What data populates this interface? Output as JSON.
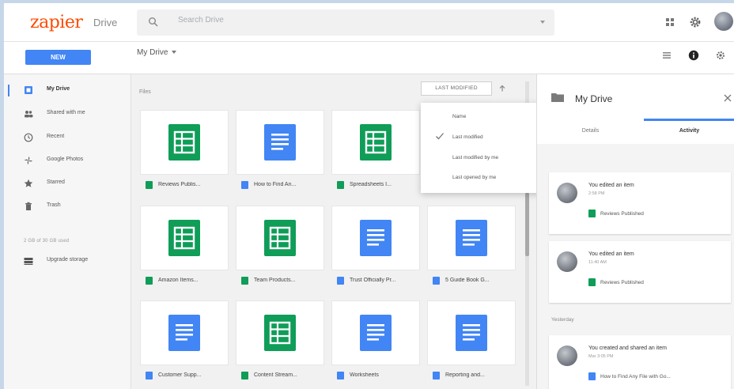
{
  "header": {
    "logo_text": "zapier",
    "product": "Drive",
    "search_placeholder": "Search Drive"
  },
  "toolbar": {
    "new_label": "NEW",
    "breadcrumb": "My Drive"
  },
  "sidebar": {
    "items": [
      {
        "label": "My Drive",
        "icon": "drive-icon",
        "active": true
      },
      {
        "label": "Shared with me",
        "icon": "people-icon",
        "active": false
      },
      {
        "label": "Recent",
        "icon": "clock-icon",
        "active": false
      },
      {
        "label": "Google Photos",
        "icon": "pinwheel-icon",
        "active": false
      },
      {
        "label": "Starred",
        "icon": "star-icon",
        "active": false
      },
      {
        "label": "Trash",
        "icon": "trash-icon",
        "active": false
      }
    ],
    "storage_label": "2 GB of 30 GB used",
    "upgrade_label": "Upgrade storage"
  },
  "main": {
    "files_label": "Files",
    "sort_label": "LAST MODIFIED",
    "files": [
      {
        "name": "Reviews Publis...",
        "type": "sheet"
      },
      {
        "name": "How to Find An...",
        "type": "doc"
      },
      {
        "name": "Spreadsheets I...",
        "type": "sheet"
      },
      {
        "name": "Amazon Items...",
        "type": "sheet"
      },
      {
        "name": "Team Products...",
        "type": "sheet"
      },
      {
        "name": "Trust Officially Pr...",
        "type": "doc"
      },
      {
        "name": "5 Guide Book G...",
        "type": "doc"
      },
      {
        "name": "Customer Supp...",
        "type": "doc"
      },
      {
        "name": "Content Stream...",
        "type": "sheet"
      },
      {
        "name": "Worksheets",
        "type": "doc"
      },
      {
        "name": "Reporting and...",
        "type": "doc"
      }
    ]
  },
  "sort_menu": {
    "items": [
      {
        "label": "Name",
        "checked": false
      },
      {
        "label": "Last modified",
        "checked": true
      },
      {
        "label": "Last modified by me",
        "checked": false
      },
      {
        "label": "Last opened by me",
        "checked": false
      }
    ]
  },
  "panel": {
    "title": "My Drive",
    "tabs": [
      {
        "label": "Details",
        "active": false
      },
      {
        "label": "Activity",
        "active": true
      }
    ],
    "section_this_week": "",
    "section_earlier": "Yesterday",
    "activities": [
      {
        "title": "You edited an item",
        "time": "2:58 PM",
        "file": "Reviews Published",
        "file_type": "sheet"
      },
      {
        "title": "You edited an item",
        "time": "11:40 AM",
        "file": "Reviews Published",
        "file_type": "sheet"
      },
      {
        "title": "You created and shared an item",
        "time": "Mar 3:05 PM",
        "file": "How to Find Any File with Go...",
        "file_type": "doc"
      }
    ]
  },
  "colors": {
    "accent": "#4285f4",
    "sheets": "#0f9d58",
    "brand": "#ff4a00"
  }
}
